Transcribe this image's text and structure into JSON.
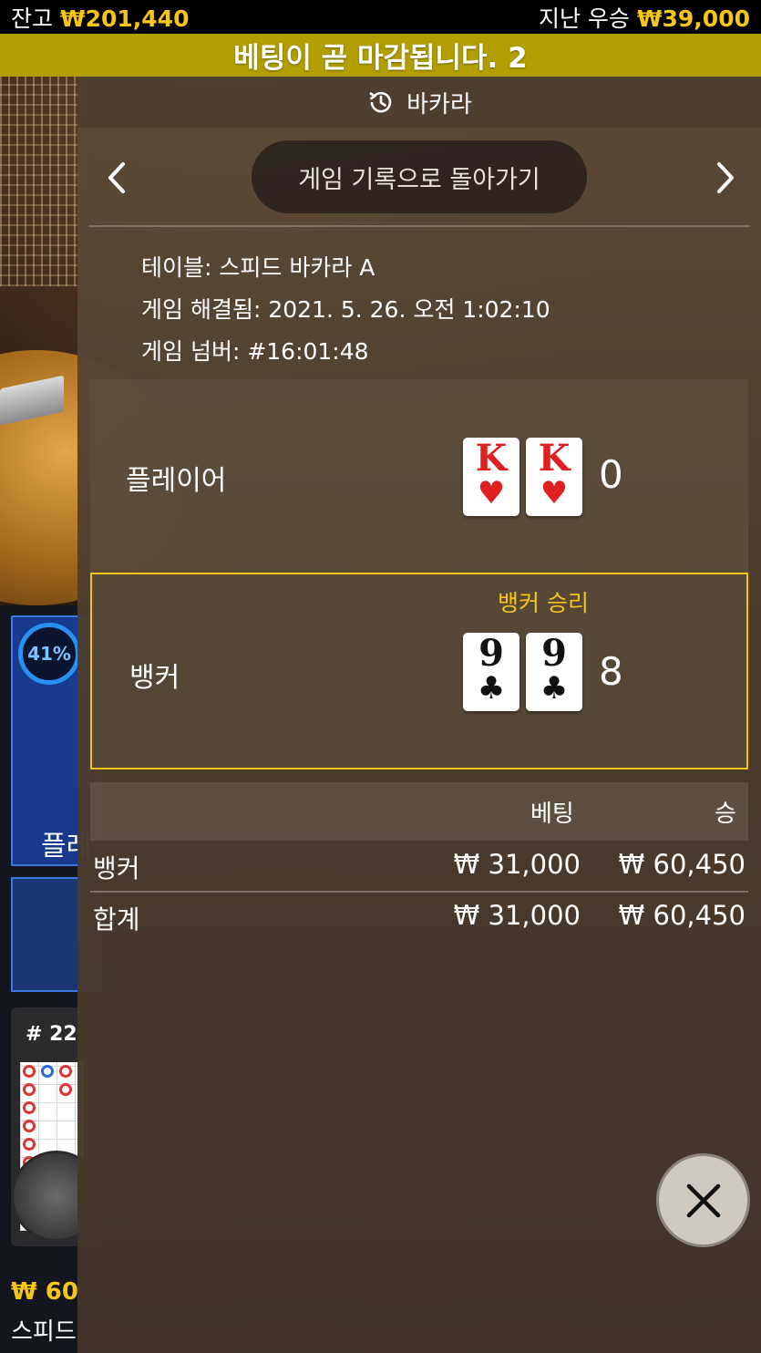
{
  "status_bar": {
    "balance_label": "잔고",
    "balance_value": "₩201,440",
    "last_win_label": "지난 우승",
    "last_win_value": "₩39,000"
  },
  "countdown": {
    "text": "베팅이 곧 마감됩니다. 2"
  },
  "history": {
    "title": "바카라",
    "back_button": "게임 기록으로 돌아가기",
    "table_line": "테이블: 스피드 바카라 A",
    "resolved_line": "게임 해결됨: 2021. 5. 26. 오전 1:02:10",
    "number_line": "게임 넘버: #16:01:48",
    "player": {
      "label": "플레이어",
      "cards": [
        {
          "rank": "K",
          "suit": "♥",
          "color": "#e02020"
        },
        {
          "rank": "K",
          "suit": "♥",
          "color": "#e02020"
        }
      ],
      "score": "0"
    },
    "banker": {
      "label": "뱅커",
      "result": "뱅커 승리",
      "cards": [
        {
          "rank": "9",
          "suit": "♣",
          "color": "#111111"
        },
        {
          "rank": "9",
          "suit": "♣",
          "color": "#111111"
        }
      ],
      "score": "8"
    },
    "bets": {
      "header_bet": "베팅",
      "header_win": "승",
      "rows": [
        {
          "label": "뱅커",
          "bet": "₩ 31,000",
          "win": "₩ 60,450"
        },
        {
          "label": "합계",
          "bet": "₩ 31,000",
          "win": "₩ 60,450"
        }
      ]
    }
  },
  "background": {
    "percent": "41%",
    "player_label": "플레",
    "road_id": "# 22",
    "balance": "₩ 60",
    "table_name": "스피드"
  },
  "colors": {
    "accent_gold": "#f5c518",
    "countdown_bg": "#b39e00",
    "winner_border": "#f0c419"
  }
}
